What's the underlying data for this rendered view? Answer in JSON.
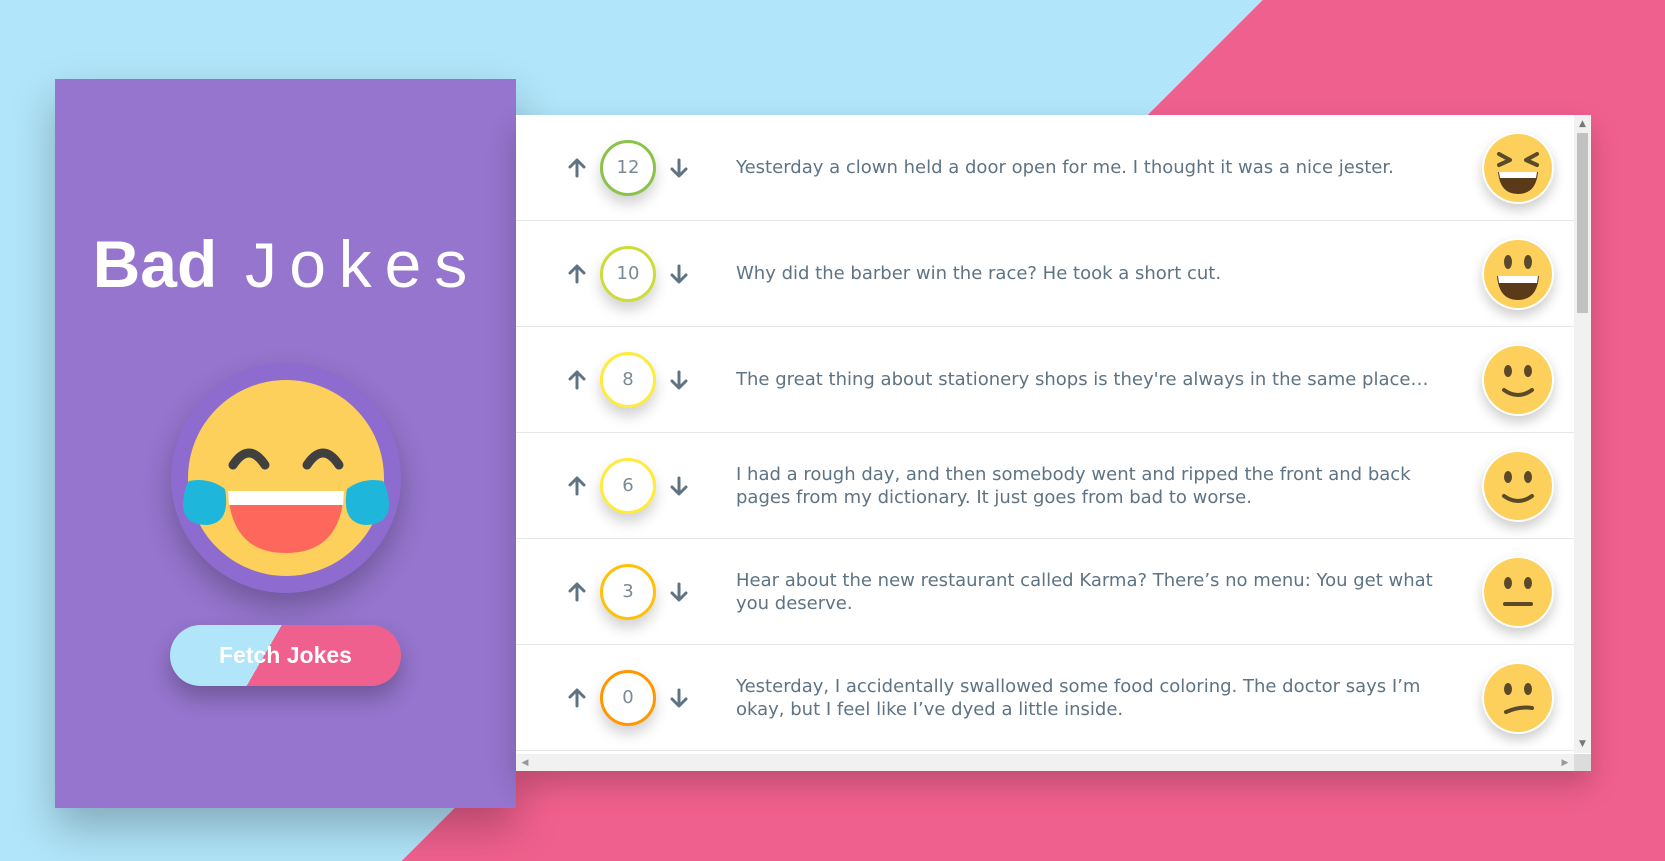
{
  "app": {
    "title_bold": "Bad",
    "title_light": "Jokes",
    "fetch_button_label": "Fetch Jokes"
  },
  "jokes": [
    {
      "score": "12",
      "text": "Yesterday a clown held a door open for me. I thought it was a nice jester.",
      "ring_color": "#8bc34a",
      "face": "laughing-squint-face-icon"
    },
    {
      "score": "10",
      "text": "Why did the barber win the race? He took a short cut.",
      "ring_color": "#cddc39",
      "face": "grinning-face-icon"
    },
    {
      "score": "8",
      "text": "The great thing about stationery shops is they're always in the same place…",
      "ring_color": "#ffeb3b",
      "face": "slightly-smiling-face-icon"
    },
    {
      "score": "6",
      "text": "I had a rough day, and then somebody went and ripped the front and back pages from my dictionary. It just goes from bad to worse.",
      "ring_color": "#ffeb3b",
      "face": "slightly-smiling-face-icon"
    },
    {
      "score": "3",
      "text": "Hear about the new restaurant called Karma? There’s no menu: You get what you deserve.",
      "ring_color": "#ffc107",
      "face": "neutral-face-icon"
    },
    {
      "score": "0",
      "text": "Yesterday, I accidentally swallowed some food coloring. The doctor says I’m okay, but I feel like I’ve dyed a little inside.",
      "ring_color": "#ff9800",
      "face": "confused-face-icon"
    }
  ],
  "colors": {
    "sidebar": "#9575cd",
    "bg_blue": "#b1e5fa",
    "bg_pink": "#f0608e",
    "emoji_yellow": "#fdd05b",
    "arrow": "#5e7384"
  }
}
